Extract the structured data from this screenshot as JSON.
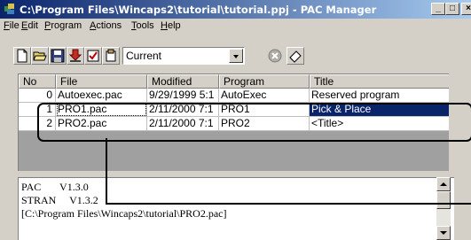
{
  "window": {
    "title": "C:\\Program Files\\Wincaps2\\tutorial\\tutorial.ppj - PAC Manager"
  },
  "menu": {
    "items": [
      {
        "key": "F",
        "rest": "ile"
      },
      {
        "key": "E",
        "rest": "dit"
      },
      {
        "key": "P",
        "rest": "rogram"
      },
      {
        "key": "A",
        "rest": "ctions"
      },
      {
        "key": "T",
        "rest": "ools"
      },
      {
        "key": "H",
        "rest": "elp"
      }
    ]
  },
  "toolbar": {
    "buttons": [
      "new-file-icon",
      "open-folder-icon",
      "save-icon",
      "download-icon",
      "check-icon",
      "clip-icon",
      "stop-icon",
      "eraser-icon"
    ],
    "combo_value": "Current"
  },
  "table": {
    "headers": [
      "No",
      "File",
      "Modified",
      "Program",
      "Title"
    ],
    "rows": [
      {
        "no": "0",
        "file": "Autoexec.pac",
        "modified": "9/29/1999 5:1",
        "program": "AutoExec",
        "title": "Reserved program"
      },
      {
        "no": "1",
        "file": "PRO1.pac",
        "modified": "2/11/2000 7:1",
        "program": "PRO1",
        "title": "Pick & Place"
      },
      {
        "no": "2",
        "file": "PRO2.pac",
        "modified": "2/11/2000 7:1",
        "program": "PRO2",
        "title": "<Title>"
      }
    ]
  },
  "output": {
    "lines": [
      "PAC       V1.3.0",
      "STRAN     V1.3.2",
      "[C:\\Program Files\\Wincaps2\\tutorial\\PRO2.pac]"
    ]
  },
  "colors": {
    "titlebar_start": "#0a246a",
    "titlebar_end": "#a6caf0",
    "selection": "#0a246a",
    "face": "#d4d0c8"
  }
}
